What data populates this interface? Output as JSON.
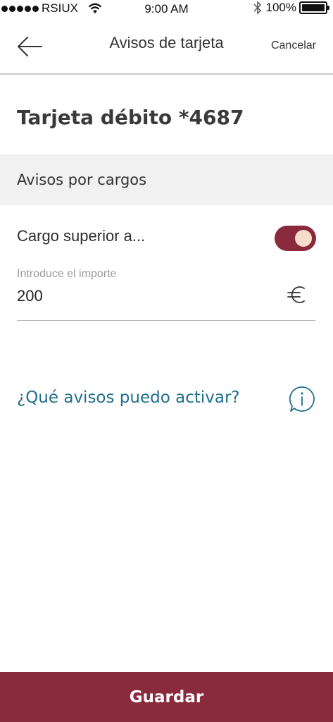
{
  "status_bar": {
    "carrier": "RSIUX",
    "time": "9:00 AM",
    "battery": "100%"
  },
  "header": {
    "title": "Avisos de tarjeta",
    "cancel_label": "Cancelar",
    "back_icon": "arrow-left-icon"
  },
  "card": {
    "title": "Tarjeta débito *4687"
  },
  "section": {
    "title": "Avisos por cargos"
  },
  "charge_alert": {
    "label": "Cargo superior a...",
    "enabled": true,
    "amount_label": "Introduce el importe",
    "amount_value": "200",
    "currency_icon": "euro-icon"
  },
  "info": {
    "link_text": "¿Qué avisos puedo activar?",
    "icon": "info-icon"
  },
  "footer": {
    "save_label": "Guardar"
  },
  "colors": {
    "brand": "#8a2a3d",
    "link": "#1f6f8b",
    "section_bg": "#f1f1f2",
    "knob": "#f7dccb"
  }
}
